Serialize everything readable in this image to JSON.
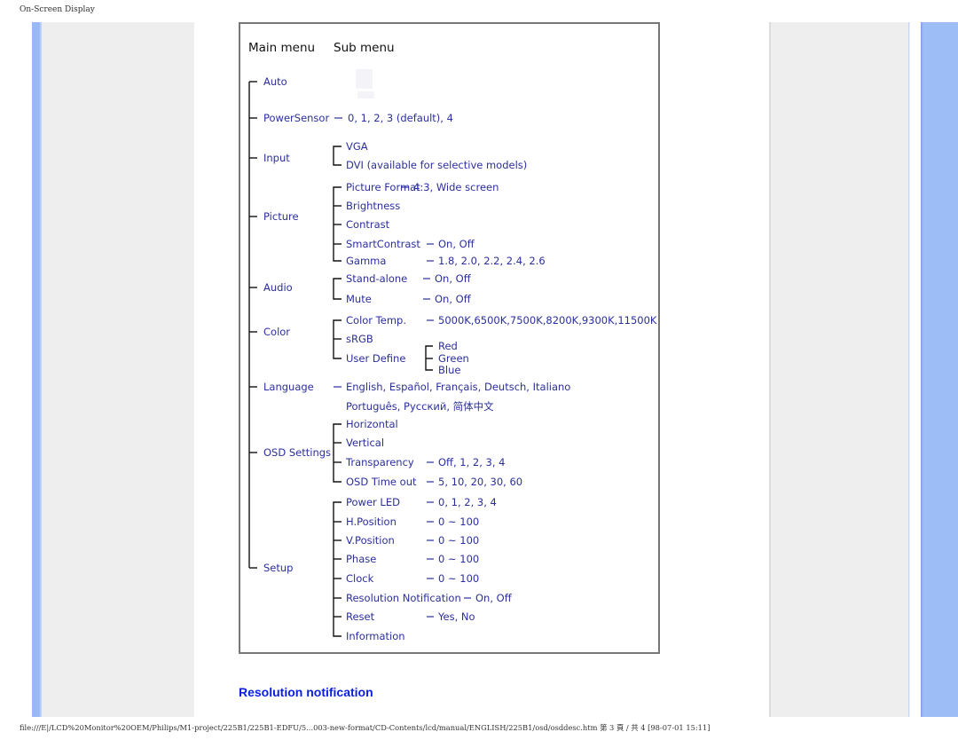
{
  "page": {
    "header": "On-Screen Display",
    "footer": "file:///E|/LCD%20Monitor%20OEM/Philips/M1-project/225B1/225B1-EDFU/5...003-new-format/CD-Contents/lcd/manual/ENGLISH/225B1/osd/osddesc.htm 第 3 頁 / 共 4 [98-07-01 15:11]",
    "section_title": "Resolution notification"
  },
  "colors": {
    "item_text": "#2b2f9c",
    "section_title": "#0a1ee0",
    "side_bar": "#9dbdf7",
    "panel_bg": "#eeeeee"
  },
  "diagram": {
    "headers": {
      "main": "Main menu",
      "sub": "Sub menu"
    },
    "menus": [
      {
        "label": "Auto",
        "subs": []
      },
      {
        "label": "PowerSensor",
        "value": "0, 1, 2, 3 (default), 4",
        "subs": []
      },
      {
        "label": "Input",
        "subs": [
          {
            "label": "VGA"
          },
          {
            "label": "DVI (available for selective models)"
          }
        ]
      },
      {
        "label": "Picture",
        "subs": [
          {
            "label": "Picture Format",
            "value": "4:3, Wide screen"
          },
          {
            "label": "Brightness"
          },
          {
            "label": "Contrast"
          },
          {
            "label": "SmartContrast",
            "value": "On, Off"
          },
          {
            "label": "Gamma",
            "value": "1.8, 2.0, 2.2, 2.4, 2.6"
          }
        ]
      },
      {
        "label": "Audio",
        "subs": [
          {
            "label": "Stand-alone",
            "value": "On, Off"
          },
          {
            "label": "Mute",
            "value": "On, Off"
          }
        ]
      },
      {
        "label": "Color",
        "subs": [
          {
            "label": "Color Temp.",
            "value": "5000K,6500K,7500K,8200K,9300K,11500K"
          },
          {
            "label": "sRGB"
          },
          {
            "label": "User Define",
            "children": [
              "Red",
              "Green",
              "Blue"
            ]
          }
        ]
      },
      {
        "label": "Language",
        "value": "English, Español, Français, Deutsch, Italiano",
        "value2": "Português, Русский, 简体中文",
        "subs": []
      },
      {
        "label": "OSD Settings",
        "subs": [
          {
            "label": "Horizontal"
          },
          {
            "label": "Vertical"
          },
          {
            "label": "Transparency",
            "value": "Off, 1, 2, 3, 4"
          },
          {
            "label": "OSD Time out",
            "value": "5, 10, 20, 30, 60"
          }
        ]
      },
      {
        "label": "Setup",
        "subs": [
          {
            "label": "Power LED",
            "value": "0, 1, 2, 3, 4"
          },
          {
            "label": "H.Position",
            "value": "0 ~ 100"
          },
          {
            "label": "V.Position",
            "value": "0 ~ 100"
          },
          {
            "label": "Phase",
            "value": "0 ~ 100"
          },
          {
            "label": "Clock",
            "value": "0 ~ 100"
          },
          {
            "label": "Resolution Notification",
            "value": "On, Off"
          },
          {
            "label": "Reset",
            "value": "Yes, No"
          },
          {
            "label": "Information"
          }
        ]
      }
    ]
  }
}
